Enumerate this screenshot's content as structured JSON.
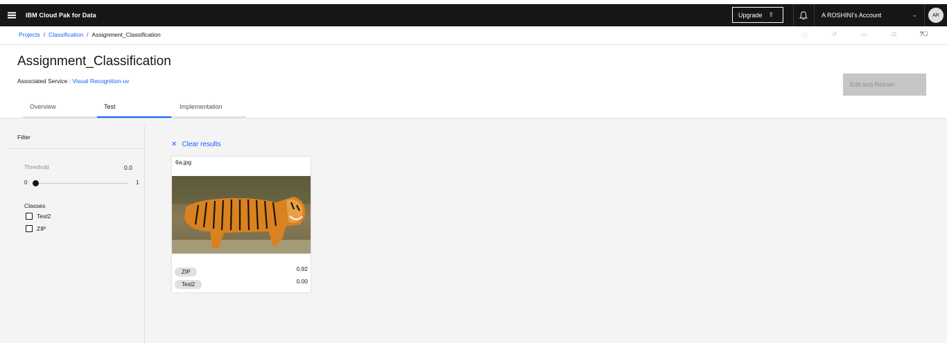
{
  "header": {
    "brand": "IBM Cloud Pak for Data",
    "upgrade_label": "Upgrade",
    "account": "A ROSHINI's Account",
    "avatar": "AR"
  },
  "breadcrumb": {
    "items": [
      "Projects",
      "Classification",
      "Assignment_Classification"
    ]
  },
  "page": {
    "title": "Assignment_Classification",
    "associated_label": "Associated Service : ",
    "associated_link": "Visual Recognition-uv",
    "edit_retrain": "Edit and Retrain",
    "tabs": [
      {
        "label": "Overview"
      },
      {
        "label": "Test"
      },
      {
        "label": "Implementation"
      }
    ]
  },
  "filter": {
    "title": "Filter",
    "threshold_label": "Threshold",
    "threshold_value": "0.0",
    "slider_min": "0",
    "slider_max": "1",
    "classes_title": "Classes",
    "classes": [
      "Test2",
      "ZIP"
    ]
  },
  "results": {
    "clear_label": "Clear results",
    "card": {
      "filename": "6a.jpg",
      "scores": [
        {
          "class": "ZIP",
          "score": "0.92"
        },
        {
          "class": "Test2",
          "score": "0.00"
        }
      ]
    }
  }
}
